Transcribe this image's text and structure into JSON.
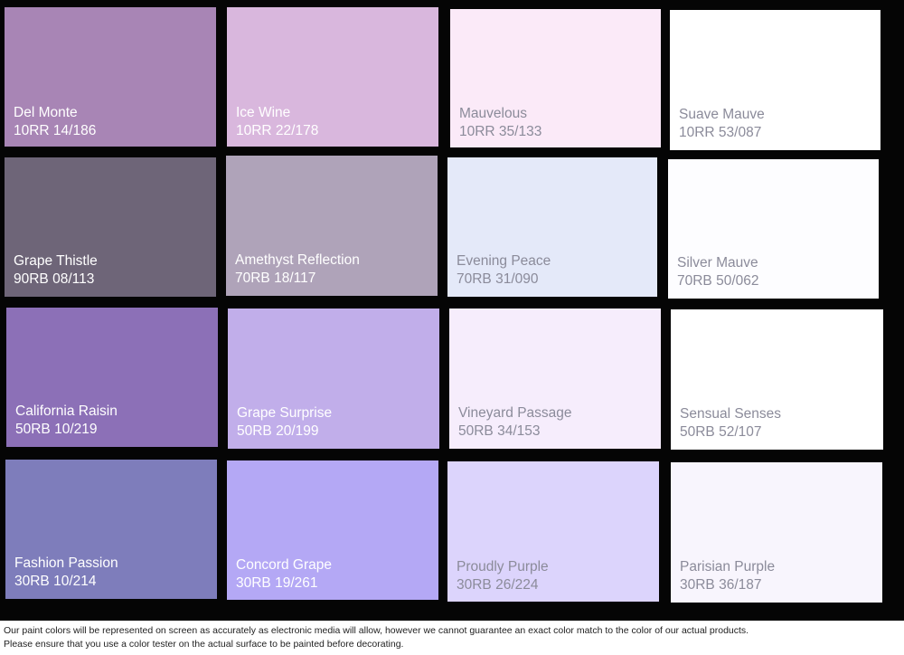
{
  "swatches": [
    {
      "name": "Del Monte",
      "code": "10RR 14/186",
      "color": "#a885b5",
      "text": "light"
    },
    {
      "name": "Ice Wine",
      "code": "10RR 22/178",
      "color": "#d9b7dd",
      "text": "light"
    },
    {
      "name": "Mauvelous",
      "code": "10RR 35/133",
      "color": "#fbeaf8",
      "text": "dark"
    },
    {
      "name": "Suave Mauve",
      "code": "10RR 53/087",
      "color": "#ffffff",
      "text": "dark"
    },
    {
      "name": "Grape Thistle",
      "code": "90RB 08/113",
      "color": "#6e6578",
      "text": "light"
    },
    {
      "name": "Amethyst Reflection",
      "code": "70RB 18/117",
      "color": "#afa3b9",
      "text": "light"
    },
    {
      "name": "Evening Peace",
      "code": "70RB 31/090",
      "color": "#e4e9f9",
      "text": "dark"
    },
    {
      "name": "Silver Mauve",
      "code": "70RB 50/062",
      "color": "#fdfdff",
      "text": "dark"
    },
    {
      "name": "California Raisin",
      "code": "50RB 10/219",
      "color": "#8c70b7",
      "text": "light"
    },
    {
      "name": "Grape Surprise",
      "code": "50RB 20/199",
      "color": "#c1aeea",
      "text": "light"
    },
    {
      "name": "Vineyard Passage",
      "code": "50RB 34/153",
      "color": "#f6edfc",
      "text": "dark"
    },
    {
      "name": "Sensual Senses",
      "code": "50RB 52/107",
      "color": "#ffffff",
      "text": "dark"
    },
    {
      "name": "Fashion Passion",
      "code": "30RB 10/214",
      "color": "#7e7dbb",
      "text": "light"
    },
    {
      "name": "Concord Grape",
      "code": "30RB 19/261",
      "color": "#b4a8f5",
      "text": "light"
    },
    {
      "name": "Proudly Purple",
      "code": "30RB 26/224",
      "color": "#dcd4fc",
      "text": "dark"
    },
    {
      "name": "Parisian Purple",
      "code": "30RB 36/187",
      "color": "#f8f5fd",
      "text": "dark"
    }
  ],
  "disclaimer": {
    "line1": "Our paint colors will be represented on screen as accurately as electronic media will allow, however we cannot guarantee an exact color match to the color of our actual products.",
    "line2": "Please ensure that you use a color tester on the actual surface to be painted before decorating."
  }
}
